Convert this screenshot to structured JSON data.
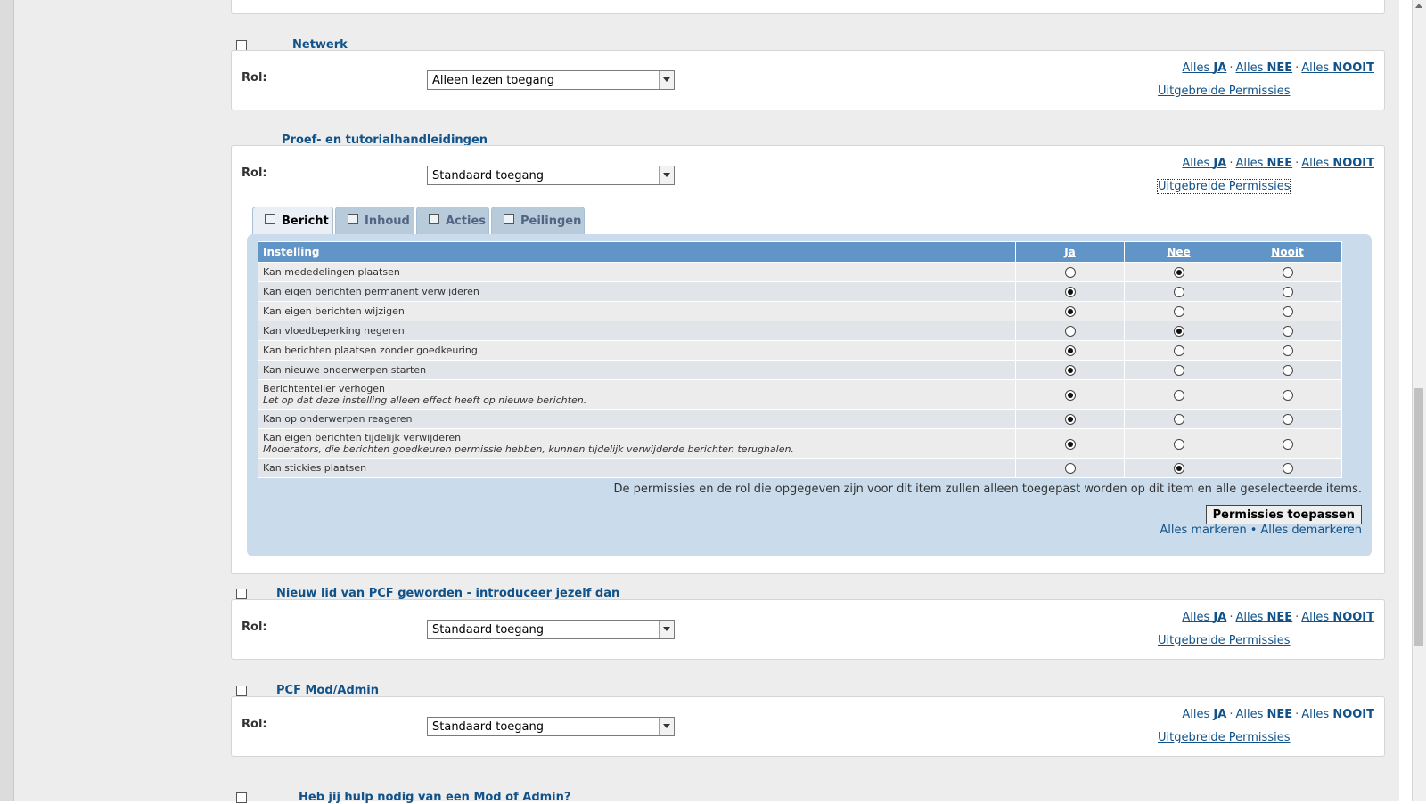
{
  "common": {
    "rol_label": "Rol:",
    "alles_word": "Alles",
    "ja": "JA",
    "nee": "NEE",
    "nooit": "NOOIT",
    "dot": "·",
    "advanced": "Uitgebreide Permissies"
  },
  "sections": [
    {
      "title": "Netwerk",
      "role": "Alleen lezen toegang"
    },
    {
      "title": "Proef- en tutorialhandleidingen",
      "role": "Standaard toegang"
    },
    {
      "title": "Nieuw lid van PCF geworden - introduceer jezelf dan",
      "role": "Standaard toegang"
    },
    {
      "title": "PCF Mod/Admin",
      "role": "Standaard toegang"
    },
    {
      "title": "Heb jij hulp nodig van een Mod of Admin?"
    }
  ],
  "tabs": [
    "Bericht",
    "Inhoud",
    "Acties",
    "Peilingen"
  ],
  "table": {
    "headers": {
      "setting": "Instelling",
      "ja": "Ja",
      "nee": "Nee",
      "nooit": "Nooit"
    },
    "rows": [
      {
        "label": "Kan mededelingen plaatsen",
        "explain": "",
        "value": "nee"
      },
      {
        "label": "Kan eigen berichten permanent verwijderen",
        "explain": "",
        "value": "ja"
      },
      {
        "label": "Kan eigen berichten wijzigen",
        "explain": "",
        "value": "ja"
      },
      {
        "label": "Kan vloedbeperking negeren",
        "explain": "",
        "value": "nee"
      },
      {
        "label": "Kan berichten plaatsen zonder goedkeuring",
        "explain": "",
        "value": "ja"
      },
      {
        "label": "Kan nieuwe onderwerpen starten",
        "explain": "",
        "value": "ja"
      },
      {
        "label": "Berichtenteller verhogen",
        "explain": "Let op dat deze instelling alleen effect heeft op nieuwe berichten.",
        "value": "ja"
      },
      {
        "label": "Kan op onderwerpen reageren",
        "explain": "",
        "value": "ja"
      },
      {
        "label": "Kan eigen berichten tijdelijk verwijderen",
        "explain": "Moderators, die berichten goedkeuren permissie hebben, kunnen tijdelijk verwijderde berichten terughalen.",
        "value": "ja"
      },
      {
        "label": "Kan stickies plaatsen",
        "explain": "",
        "value": "nee"
      }
    ]
  },
  "note": "De permissies en de rol die opgegeven zijn voor dit item zullen alleen toegepast worden op dit item en alle geselecteerde items.",
  "apply_button": "Permissies toepassen",
  "mark_all": "Alles markeren",
  "bullet": "•",
  "unmark_all": "Alles demarkeren"
}
